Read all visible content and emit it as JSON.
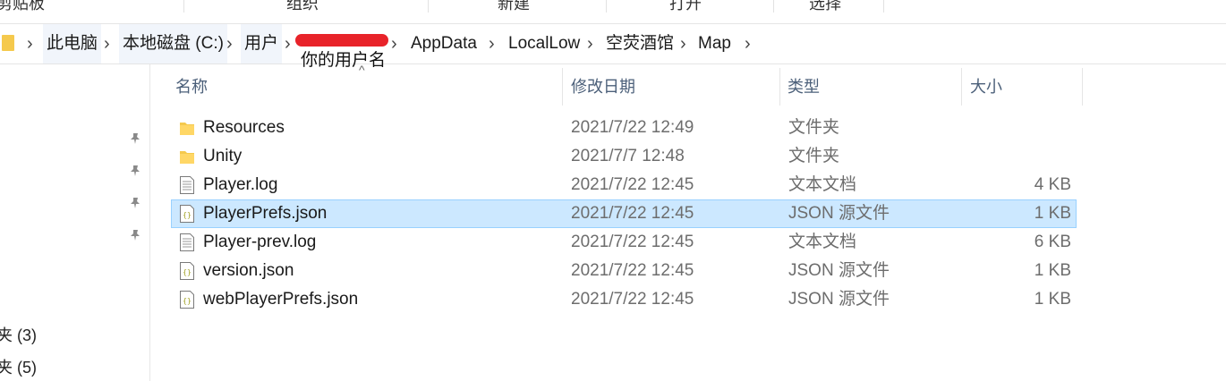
{
  "ribbon": {
    "groups": [
      "剪贴板",
      "组织",
      "新建",
      "打开",
      "选择"
    ]
  },
  "breadcrumb": {
    "items": [
      "此电脑",
      "本地磁盘 (C:)",
      "用户",
      "AppData",
      "LocalLow",
      "空荧酒馆",
      "Map"
    ],
    "annotation": "你的用户名"
  },
  "nav": {
    "items": [
      "夹 (3)",
      "夹 (5)"
    ]
  },
  "columns": {
    "name": "名称",
    "date": "修改日期",
    "type": "类型",
    "size": "大小"
  },
  "files": [
    {
      "name": "Resources",
      "date": "2021/7/22 12:49",
      "type": "文件夹",
      "size": "",
      "icon": "folder-icon"
    },
    {
      "name": "Unity",
      "date": "2021/7/7 12:48",
      "type": "文件夹",
      "size": "",
      "icon": "folder-icon"
    },
    {
      "name": "Player.log",
      "date": "2021/7/22 12:45",
      "type": "文本文档",
      "size": "4 KB",
      "icon": "text-file-icon"
    },
    {
      "name": "PlayerPrefs.json",
      "date": "2021/7/22 12:45",
      "type": "JSON 源文件",
      "size": "1 KB",
      "icon": "json-file-icon"
    },
    {
      "name": "Player-prev.log",
      "date": "2021/7/22 12:45",
      "type": "文本文档",
      "size": "6 KB",
      "icon": "text-file-icon"
    },
    {
      "name": "version.json",
      "date": "2021/7/22 12:45",
      "type": "JSON 源文件",
      "size": "1 KB",
      "icon": "json-file-icon"
    },
    {
      "name": "webPlayerPrefs.json",
      "date": "2021/7/22 12:45",
      "type": "JSON 源文件",
      "size": "1 KB",
      "icon": "json-file-icon"
    }
  ],
  "colors": {
    "selection": "#cce8ff",
    "selection_border": "#99d1ff",
    "redaction": "#e8232a",
    "folder": "#f5c94d"
  }
}
